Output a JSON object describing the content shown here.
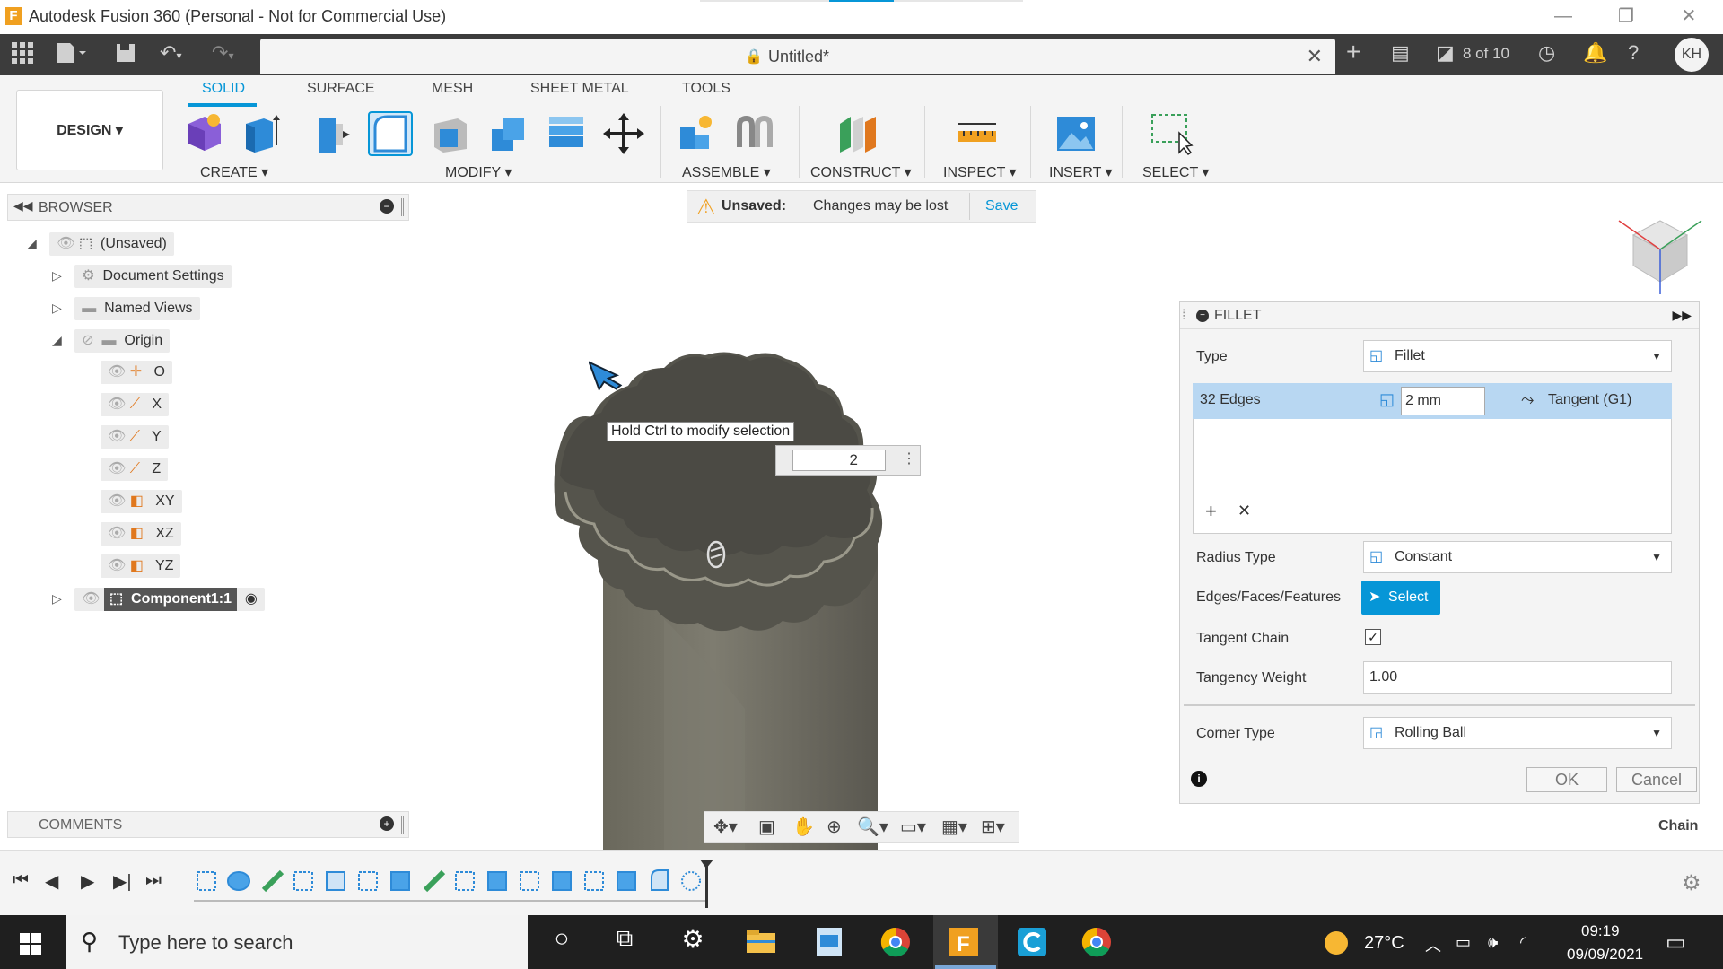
{
  "window": {
    "title": "Autodesk Fusion 360 (Personal - Not for Commercial Use)",
    "logo_letter": "F"
  },
  "tabbar": {
    "doc_title": "Untitled*",
    "version_count": "8 of 10",
    "user_initials": "KH"
  },
  "ribbon": {
    "workspace": "DESIGN",
    "tabs": [
      "SOLID",
      "SURFACE",
      "MESH",
      "SHEET METAL",
      "TOOLS"
    ],
    "active_tab": "SOLID",
    "groups": [
      "CREATE",
      "MODIFY",
      "ASSEMBLE",
      "CONSTRUCT",
      "INSPECT",
      "INSERT",
      "SELECT"
    ]
  },
  "banner": {
    "status": "Unsaved:",
    "message": "Changes may be lost",
    "save_label": "Save"
  },
  "browser": {
    "title": "BROWSER",
    "root": "(Unsaved)",
    "items": [
      {
        "label": "Document Settings"
      },
      {
        "label": "Named Views"
      },
      {
        "label": "Origin"
      }
    ],
    "origin_children": [
      "O",
      "X",
      "Y",
      "Z",
      "XY",
      "XZ",
      "YZ"
    ],
    "component": "Component1:1"
  },
  "comments": {
    "title": "COMMENTS"
  },
  "canvas": {
    "tooltip": "Hold Ctrl to modify selection",
    "input_value": "2"
  },
  "fillet": {
    "title": "FILLET",
    "type_label": "Type",
    "type_value": "Fillet",
    "edges_label": "32 Edges",
    "radius_value": "2 mm",
    "continuity": "Tangent (G1)",
    "radius_type_label": "Radius Type",
    "radius_type_value": "Constant",
    "efs_label": "Edges/Faces/Features",
    "select_label": "Select",
    "tangent_chain_label": "Tangent Chain",
    "tangent_chain_checked": true,
    "tangency_weight_label": "Tangency Weight",
    "tangency_weight_value": "1.00",
    "corner_type_label": "Corner Type",
    "corner_type_value": "Rolling Ball",
    "ok_label": "OK",
    "cancel_label": "Cancel",
    "chain_label": "Chain"
  },
  "taskbar": {
    "search_placeholder": "Type here to search",
    "temperature": "27°C",
    "time": "09:19",
    "date": "09/09/2021"
  }
}
